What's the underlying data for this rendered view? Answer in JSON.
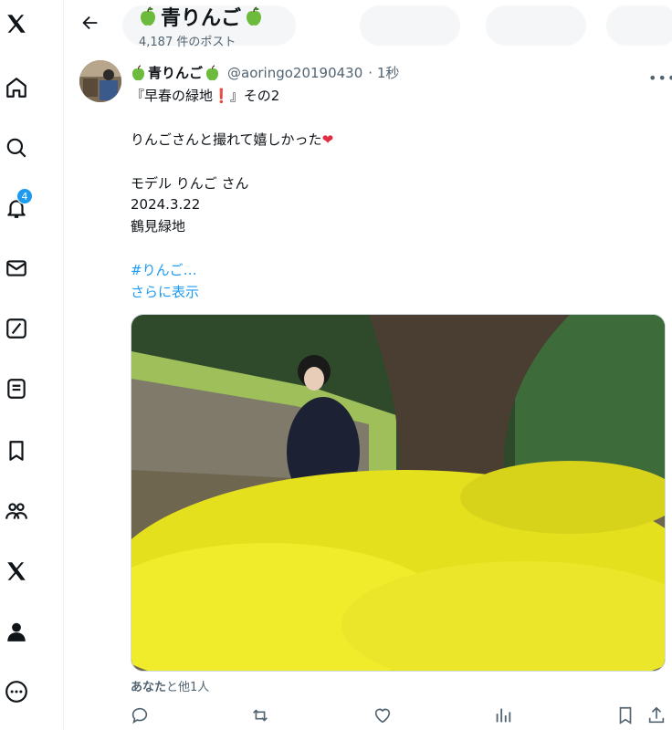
{
  "header": {
    "title": "青りんご",
    "post_count": "4,187 件のポスト"
  },
  "notifications": {
    "count": "4"
  },
  "tweet": {
    "display_name": "青りんご",
    "handle": "@aoringo20190430",
    "time": "· 1秒",
    "lines": {
      "l1_start": "『早春の緑地",
      "l1_end": "』その2",
      "l2": "りんごさんと撮れて嬉しかった",
      "l3": "モデル りんご さん",
      "l4": "2024.3.22",
      "l5": "鶴見緑地",
      "hashtag": "#りんご…",
      "show_more": "さらに表示"
    },
    "liked_by": {
      "bold": "あなた",
      "rest": "と他1人"
    }
  },
  "colors": {
    "accent": "#1d9bf0",
    "apple": "#6cbb3c",
    "heart": "#dd2e44"
  }
}
